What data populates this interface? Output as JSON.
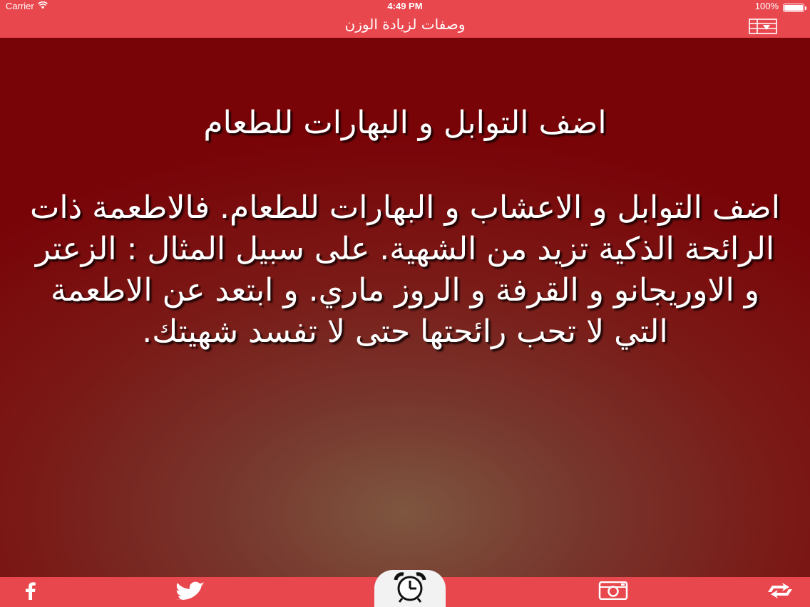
{
  "status_bar": {
    "carrier": "Carrier",
    "time": "4:49 PM",
    "battery_text": "100%"
  },
  "nav": {
    "title": "وصفات لزيادة الوزن",
    "menu_icon": "list-download-icon"
  },
  "article": {
    "title": "اضف التوابل و البهارات للطعام",
    "body": "اضف التوابل  و الاعشاب و البهارات للطعام. فالاطعمة ذات الرائحة الذكية تزيد من الشهية.  على سبيل المثال : الزعتر و الاوريجانو و  القرفة و الروز ماري. و ابتعد عن الاطعمة التي لا تحب رائحتها حتى لا تفسد شهيتك."
  },
  "tab_bar": {
    "items": [
      {
        "icon": "facebook-icon"
      },
      {
        "icon": "twitter-icon"
      },
      {
        "icon": "alarm-clock-icon"
      },
      {
        "icon": "instagram-icon"
      },
      {
        "icon": "refresh-arrows-icon"
      }
    ]
  },
  "colors": {
    "bar_red": "#e9474e",
    "background_dark_red": "#790408",
    "background_brown": "#7e5640",
    "text": "#ffffff"
  }
}
